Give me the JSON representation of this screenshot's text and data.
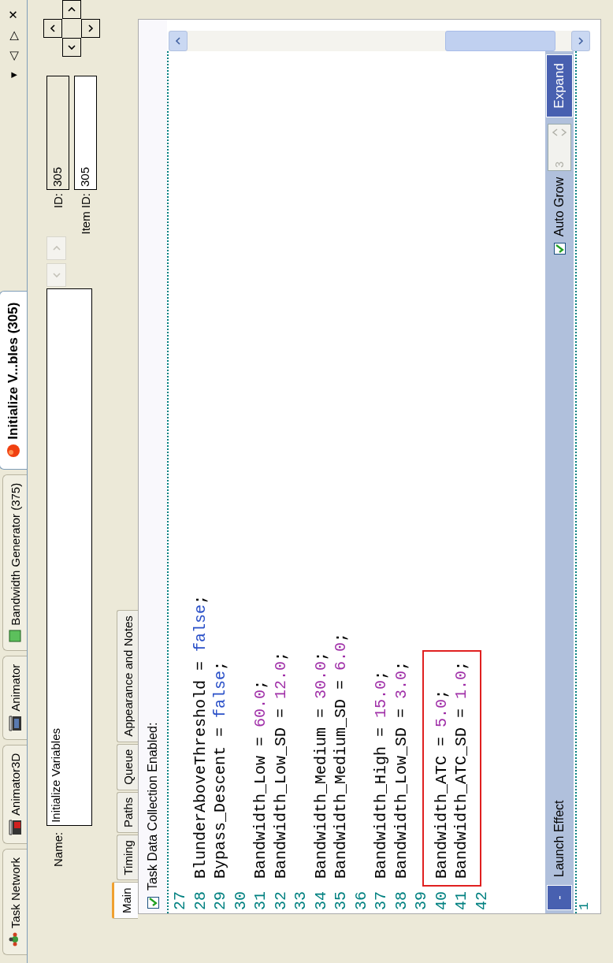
{
  "document_tabs": [
    {
      "label": "Task Network",
      "selected": false
    },
    {
      "label": "Animator3D",
      "selected": false
    },
    {
      "label": "Animator",
      "selected": false
    },
    {
      "label": "Bandwidth Generator (375)",
      "selected": false
    },
    {
      "label": "Initialize V...bles  (305)",
      "selected": true
    }
  ],
  "tab_controls": [
    "▾",
    "◁",
    "▷",
    "✕"
  ],
  "name_field": {
    "label": "Name:",
    "value": "Initialize Variables"
  },
  "record_nav": {
    "disabled": true
  },
  "id_field": {
    "label": "ID:",
    "value": "305",
    "disabled": true
  },
  "item_id_field": {
    "label": "Item ID:",
    "value": "305",
    "disabled": false
  },
  "sub_tabs": [
    {
      "label": "Main",
      "selected": true
    },
    {
      "label": "Timing",
      "selected": false
    },
    {
      "label": "Paths",
      "selected": false
    },
    {
      "label": "Queue",
      "selected": false
    },
    {
      "label": "Appearance and Notes",
      "selected": false
    }
  ],
  "data_collection": {
    "label": "Task Data Collection Enabled:",
    "checked": true
  },
  "code_lines": [
    {
      "number": "27",
      "highlighted": false
    },
    {
      "number": "28",
      "highlighted": false,
      "tokens": [
        {
          "text": "BlunderAboveThreshold = ",
          "kind": "plain"
        },
        {
          "text": "false",
          "kind": "keyword"
        },
        {
          "text": ";",
          "kind": "plain"
        }
      ]
    },
    {
      "number": "29",
      "highlighted": false,
      "tokens": [
        {
          "text": "Bypass_Descent = ",
          "kind": "plain"
        },
        {
          "text": "false",
          "kind": "keyword"
        },
        {
          "text": ";",
          "kind": "plain"
        }
      ]
    },
    {
      "number": "30",
      "highlighted": false
    },
    {
      "number": "31",
      "highlighted": false,
      "tokens": [
        {
          "text": "Bandwidth_Low = ",
          "kind": "plain"
        },
        {
          "text": "60.0",
          "kind": "number"
        },
        {
          "text": ";",
          "kind": "plain"
        }
      ]
    },
    {
      "number": "32",
      "highlighted": false,
      "tokens": [
        {
          "text": "Bandwidth_Low_SD = ",
          "kind": "plain"
        },
        {
          "text": "12.0",
          "kind": "number"
        },
        {
          "text": ";",
          "kind": "plain"
        }
      ]
    },
    {
      "number": "33",
      "highlighted": false
    },
    {
      "number": "34",
      "highlighted": false,
      "tokens": [
        {
          "text": "Bandwidth_Medium = ",
          "kind": "plain"
        },
        {
          "text": "30.0",
          "kind": "number"
        },
        {
          "text": ";",
          "kind": "plain"
        }
      ]
    },
    {
      "number": "35",
      "highlighted": false,
      "tokens": [
        {
          "text": "Bandwidth_Medium_SD = ",
          "kind": "plain"
        },
        {
          "text": "6.0",
          "kind": "number"
        },
        {
          "text": ";",
          "kind": "plain"
        }
      ]
    },
    {
      "number": "36",
      "highlighted": false
    },
    {
      "number": "37",
      "highlighted": false,
      "tokens": [
        {
          "text": "Bandwidth_High = ",
          "kind": "plain"
        },
        {
          "text": "15.0",
          "kind": "number"
        },
        {
          "text": ";",
          "kind": "plain"
        }
      ]
    },
    {
      "number": "38",
      "highlighted": false,
      "tokens": [
        {
          "text": "Bandwidth_Low_SD = ",
          "kind": "plain"
        },
        {
          "text": "3.0",
          "kind": "number"
        },
        {
          "text": ";",
          "kind": "plain"
        }
      ]
    },
    {
      "number": "39",
      "highlighted": false
    },
    {
      "number": "40",
      "highlighted": true,
      "tokens": [
        {
          "text": "Bandwidth_ATC = ",
          "kind": "plain"
        },
        {
          "text": "5.0",
          "kind": "number"
        },
        {
          "text": ";",
          "kind": "plain"
        }
      ]
    },
    {
      "number": "41",
      "highlighted": true,
      "tokens": [
        {
          "text": "Bandwidth_ATC_SD = ",
          "kind": "plain"
        },
        {
          "text": "1.0",
          "kind": "number"
        },
        {
          "text": ";",
          "kind": "plain"
        }
      ]
    },
    {
      "number": "42",
      "highlighted": false
    }
  ],
  "effect_bar": {
    "collapse_button": "-",
    "label": "Launch Effect",
    "auto_grow": {
      "label": "Auto Grow",
      "checked": true
    },
    "spinner": {
      "value": "3",
      "disabled": true
    },
    "expand_button": "Expand"
  },
  "second_editor_lines": [
    "1"
  ]
}
